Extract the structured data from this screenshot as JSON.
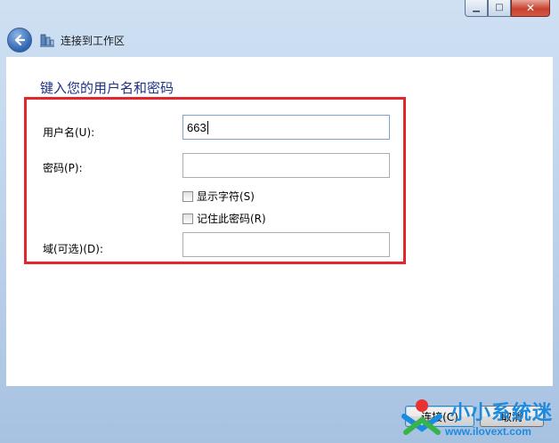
{
  "window": {
    "nav_title": "连接到工作区",
    "controls": {
      "minimize": "▁",
      "maximize": "□",
      "close": "✕"
    }
  },
  "form": {
    "heading": "键入您的用户名和密码",
    "username_label": "用户名(U):",
    "username_value": "663",
    "password_label": "密码(P):",
    "password_value": "",
    "show_chars_label": "显示字符(S)",
    "show_chars_checked": false,
    "remember_label": "记住此密码(R)",
    "remember_checked": false,
    "domain_label": "域(可选)(D):",
    "domain_value": ""
  },
  "buttons": {
    "connect": "连接(C)",
    "cancel": "取消"
  },
  "watermark": {
    "brand": "小小系统迷",
    "url": "www.ilovext.com"
  },
  "colors": {
    "highlight_box": "#e2262b",
    "heading": "#1e3287",
    "watermark": "#1b8be0"
  }
}
